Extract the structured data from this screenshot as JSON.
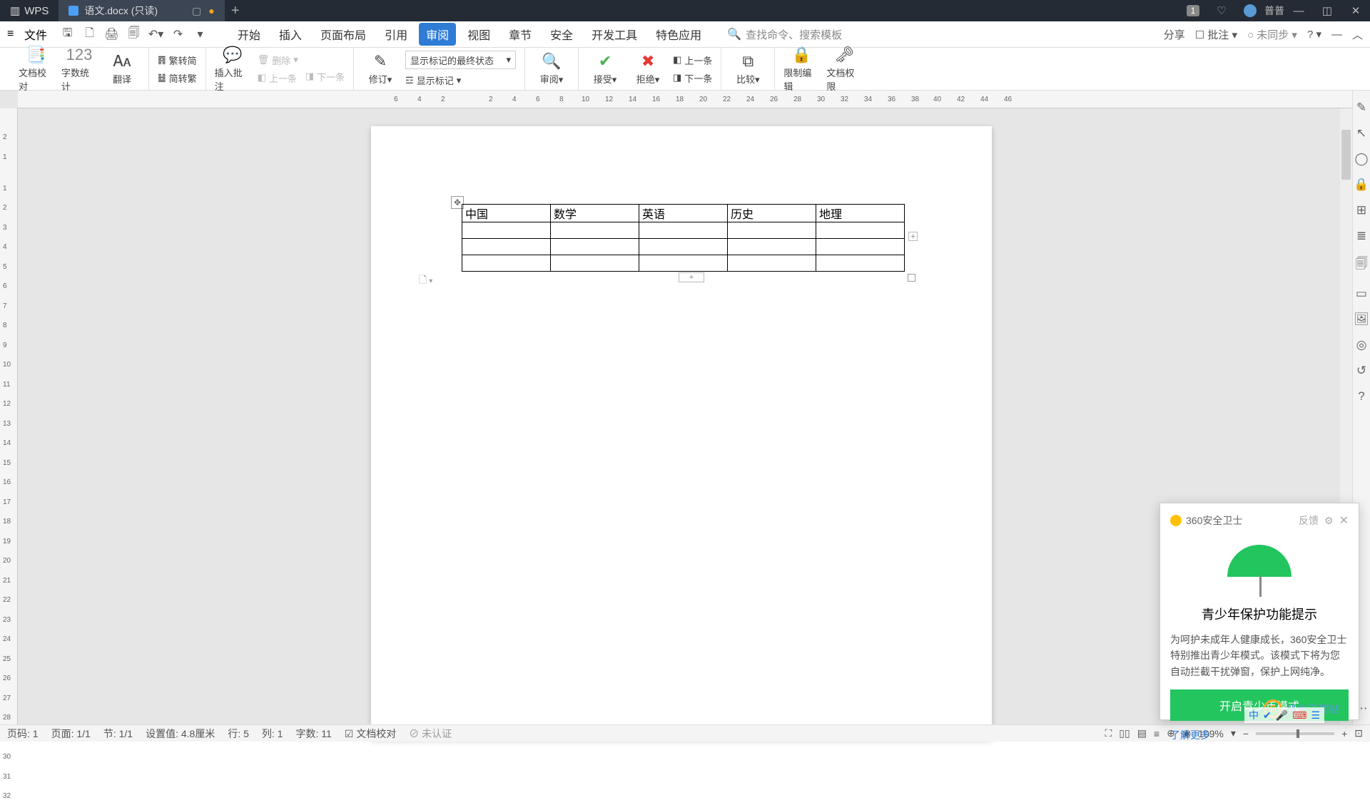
{
  "titlebar": {
    "app": "WPS",
    "tab": "语文.docx (只读)",
    "badge": "1",
    "user": "普普"
  },
  "menubar": {
    "file": "文件",
    "items": [
      "开始",
      "插入",
      "页面布局",
      "引用",
      "审阅",
      "视图",
      "章节",
      "安全",
      "开发工具",
      "特色应用"
    ],
    "active_index": 4,
    "search_icon": "🔍",
    "search": "查找命令、搜索模板",
    "right": {
      "share": "分享",
      "annotate": "批注",
      "sync": "未同步"
    }
  },
  "ribbon": {
    "proofing": "文档校对",
    "wordcount": "字数统计",
    "translate": "翻译",
    "simp": "繁转简",
    "trad": "简转繁",
    "insert_comment": "插入批注",
    "delete": "删除",
    "revise": "修订",
    "show_markup": "显示标记",
    "markup_state": "显示标记的最终状态",
    "review": "审阅",
    "accept": "接受",
    "reject": "拒绝",
    "prev": "上一条",
    "next": "下一条",
    "compare": "比较",
    "restrict": "限制编辑",
    "doc_perm": "文档权限"
  },
  "table": {
    "headers": [
      "中国",
      "数学",
      "英语",
      "历史",
      "地理"
    ]
  },
  "status": {
    "page_no": "页码: 1",
    "page": "页面: 1/1",
    "section": "节: 1/1",
    "position": "设置值: 4.8厘米",
    "line": "行: 5",
    "col": "列: 1",
    "words": "字数: 11",
    "proofing": "文档校对",
    "auth": "未认证",
    "zoom": "109%"
  },
  "popup": {
    "source": "360安全卫士",
    "feedback": "反馈",
    "title": "青少年保护功能提示",
    "body": "为呵护未成年人健康成长，360安全卫士特别推出青少年模式。该模式下将为您自动拦截干扰弹窗，保护上网纯净。",
    "button": "开启青少年模式",
    "link": "了解更多"
  },
  "watermark": "极光下载站",
  "ime": "中"
}
